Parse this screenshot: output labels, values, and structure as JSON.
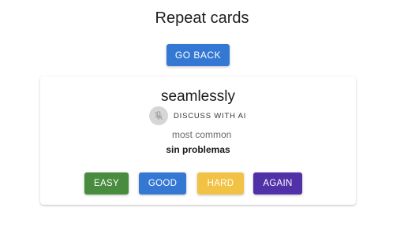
{
  "page": {
    "title": "Repeat cards",
    "back_label": "GO BACK"
  },
  "card": {
    "word": "seamlessly",
    "ai_label": "DISCUSS WITH AI",
    "meaning_label": "most common",
    "translation": "sin problemas"
  },
  "answers": [
    {
      "label": "EASY",
      "color": "#4a8c3f",
      "icon": ""
    },
    {
      "label": "GOOD",
      "color": "#3478d4",
      "icon": ""
    },
    {
      "label": "HARD",
      "color": "#f2c244",
      "icon": ""
    },
    {
      "label": "AGAIN",
      "color": "#5031a8",
      "icon": ""
    }
  ],
  "icons": {
    "ai_mic": "microphone-off-icon"
  },
  "colors": {
    "primary": "#3478d4",
    "mic_circle": "#d6d6d6"
  }
}
